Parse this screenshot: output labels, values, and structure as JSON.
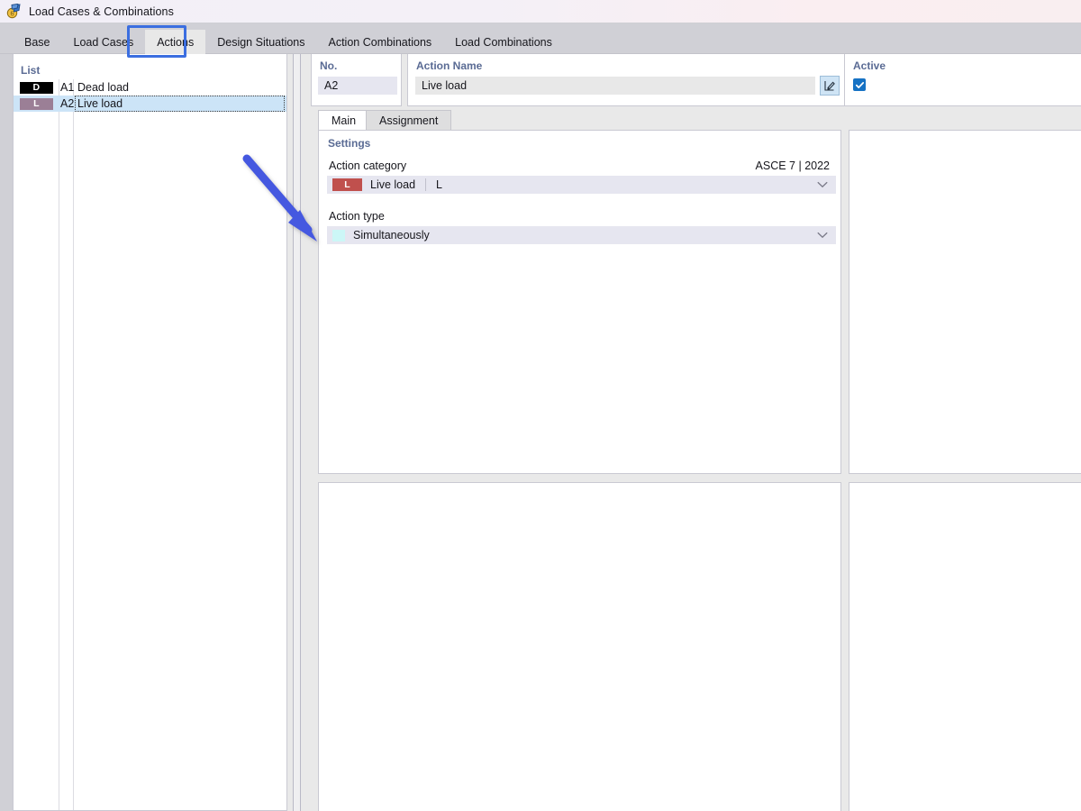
{
  "window": {
    "title": "Load Cases & Combinations",
    "icon": "load-combinations-icon"
  },
  "tabs": {
    "items": [
      {
        "label": "Base",
        "active": false
      },
      {
        "label": "Load Cases",
        "active": false
      },
      {
        "label": "Actions",
        "active": true
      },
      {
        "label": "Design Situations",
        "active": false
      },
      {
        "label": "Action Combinations",
        "active": false
      },
      {
        "label": "Load Combinations",
        "active": false
      }
    ],
    "highlighted": "Actions"
  },
  "list_panel": {
    "caption": "List",
    "rows": [
      {
        "badge": "D",
        "badge_color": "#000000",
        "no": "A1",
        "name": "Dead load",
        "selected": false
      },
      {
        "badge": "L",
        "badge_color": "#9b7f96",
        "no": "A2",
        "name": "Live load",
        "selected": true
      }
    ]
  },
  "header": {
    "no_caption": "No.",
    "no_value": "A2",
    "name_caption": "Action Name",
    "name_value": "Live load",
    "edit_icon": "pencil-edit-icon",
    "active_caption": "Active",
    "active_checked": true
  },
  "inner_tabs": {
    "items": [
      {
        "label": "Main",
        "active": true
      },
      {
        "label": "Assignment",
        "active": false
      }
    ]
  },
  "settings": {
    "title": "Settings",
    "standard": "ASCE 7 | 2022",
    "action_category": {
      "label": "Action category",
      "badge": "L",
      "badge_color": "#c0504d",
      "value": "Live load",
      "abbr": "L",
      "arrow_icon": "chevron-down-icon"
    },
    "action_type": {
      "label": "Action type",
      "swatch_color": "#ccf7f7",
      "value": "Simultaneously",
      "arrow_icon": "chevron-down-icon"
    }
  },
  "annotation": {
    "arrow_color": "#4458e0",
    "points_to": "action-type-combo"
  }
}
